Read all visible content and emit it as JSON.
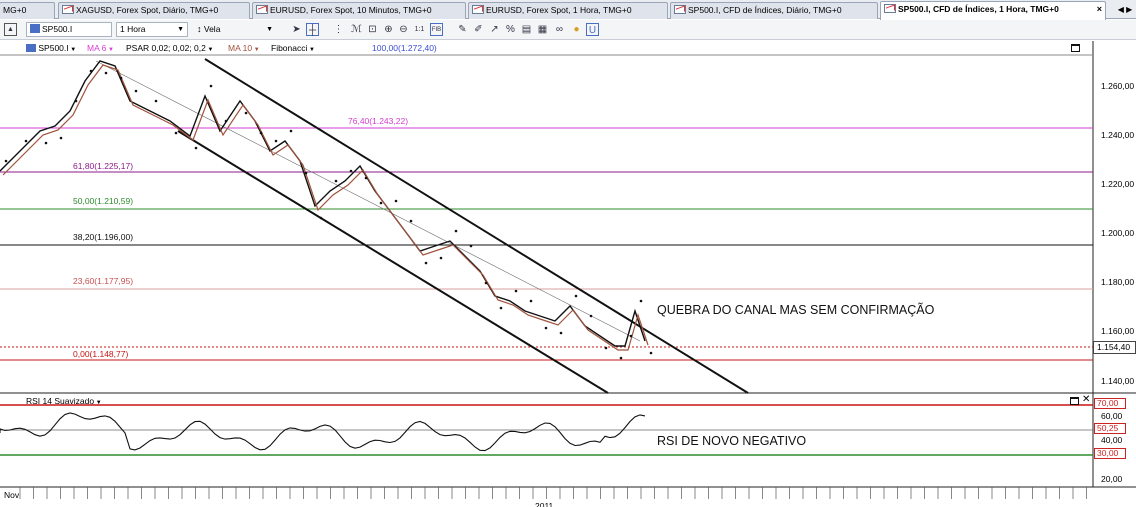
{
  "tabs": [
    {
      "label": "MG+0",
      "active": false
    },
    {
      "label": "XAGUSD, Forex Spot, Diário, TMG+0",
      "active": false
    },
    {
      "label": "EURUSD, Forex Spot, 10 Minutos, TMG+0",
      "active": false
    },
    {
      "label": "EURUSD, Forex Spot, 1 Hora, TMG+0",
      "active": false
    },
    {
      "label": "SP500.I, CFD de Índices, Diário, TMG+0",
      "active": false
    },
    {
      "label": "SP500.I, CFD de Índices, 1 Hora, TMG+0",
      "active": true
    }
  ],
  "tab_close": "×",
  "tab_scroll": "◀ ▶",
  "toolbar": {
    "symbol": "SP500.I",
    "timeframe": "1 Hora",
    "chart_type": "Vela",
    "icons": [
      "collapse-icon",
      "cursor-icon",
      "crosshair-icon",
      "grid-icon",
      "indicator-icon",
      "zoom-fit-icon",
      "zoom-in-icon",
      "zoom-out-icon",
      "zoom-reset-icon",
      "fib-icon",
      "pencil-icon",
      "paint-icon",
      "draw-icon",
      "percent-icon",
      "layout-icon",
      "template-icon",
      "link-icon",
      "alert-icon",
      "magnet-icon"
    ],
    "one_to_one": "1:1",
    "fib_text": "FIB"
  },
  "legend": {
    "symbol": "SP500.I",
    "ma6": "MA 6",
    "psar": "PSAR 0,02; 0,02; 0,2",
    "ma10": "MA 10",
    "fibonacci": "Fibonacci",
    "fib_top": "100,00(1.272,40)"
  },
  "fib_levels": [
    {
      "label": "76,40(1.243,22)",
      "color": "#d63cd6"
    },
    {
      "label": "61,80(1.225,17)",
      "color": "#8b1a8b"
    },
    {
      "label": "50,00(1.210,59)",
      "color": "#2e8b2e"
    },
    {
      "label": "38,20(1.196,00)",
      "color": "#111111"
    },
    {
      "label": "23,60(1.177,95)",
      "color": "#c85050"
    },
    {
      "label": "0,00(1.148,77)",
      "color": "#c81414"
    }
  ],
  "y_axis": [
    "1.260,00",
    "1.240,00",
    "1.220,00",
    "1.200,00",
    "1.180,00",
    "1.160,00",
    "1.140,00"
  ],
  "last_price": "1.154,40",
  "annotation_main": "QUEBRA DO CANAL MAS SEM CONFIRMAÇÃO",
  "rsi": {
    "title": "RSI 14 Suavizado",
    "axis": [
      "60,00",
      "40,00",
      "20,00"
    ],
    "levels": [
      "70,00",
      "50,25",
      "30,00"
    ],
    "annotation": "RSI DE NOVO NEGATIVO"
  },
  "time_axis": {
    "start": "Nov",
    "year": "2011"
  },
  "colors": {
    "price_line": "#c81414",
    "ma": "#a0523c",
    "channel": "#111111",
    "rsi_upper": "#c81414",
    "rsi_lower": "#2e8b2e"
  }
}
